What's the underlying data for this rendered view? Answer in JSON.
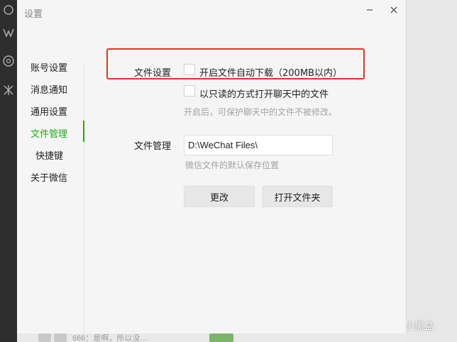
{
  "dialog": {
    "title": "设置",
    "minimize_icon": "minimize-icon",
    "close_icon": "close-icon"
  },
  "nav": {
    "items": [
      {
        "label": "账号设置",
        "active": false
      },
      {
        "label": "消息通知",
        "active": false
      },
      {
        "label": "通用设置",
        "active": false
      },
      {
        "label": "文件管理",
        "active": true
      },
      {
        "label": "快捷键",
        "active": false
      },
      {
        "label": "关于微信",
        "active": false
      }
    ]
  },
  "file_settings": {
    "label": "文件设置",
    "auto_download": {
      "label": "开启文件自动下载（200MB以内）",
      "checked": false
    },
    "read_only": {
      "label": "以只读的方式打开聊天中的文件",
      "checked": false
    },
    "read_only_hint": "开启后，可保护聊天中的文件不被修改。"
  },
  "file_management": {
    "label": "文件管理",
    "path": "D:\\WeChat Files\\",
    "path_hint": "微信文件的默认保存位置",
    "change_button": "更改",
    "open_folder_button": "打开文件夹"
  },
  "background": {
    "chat_preview": "666：是啊，所以没…",
    "watermark": "小黑盒"
  },
  "colors": {
    "accent": "#1aad19",
    "highlight": "#e8312b",
    "dialog_bg": "#f5f5f5"
  }
}
